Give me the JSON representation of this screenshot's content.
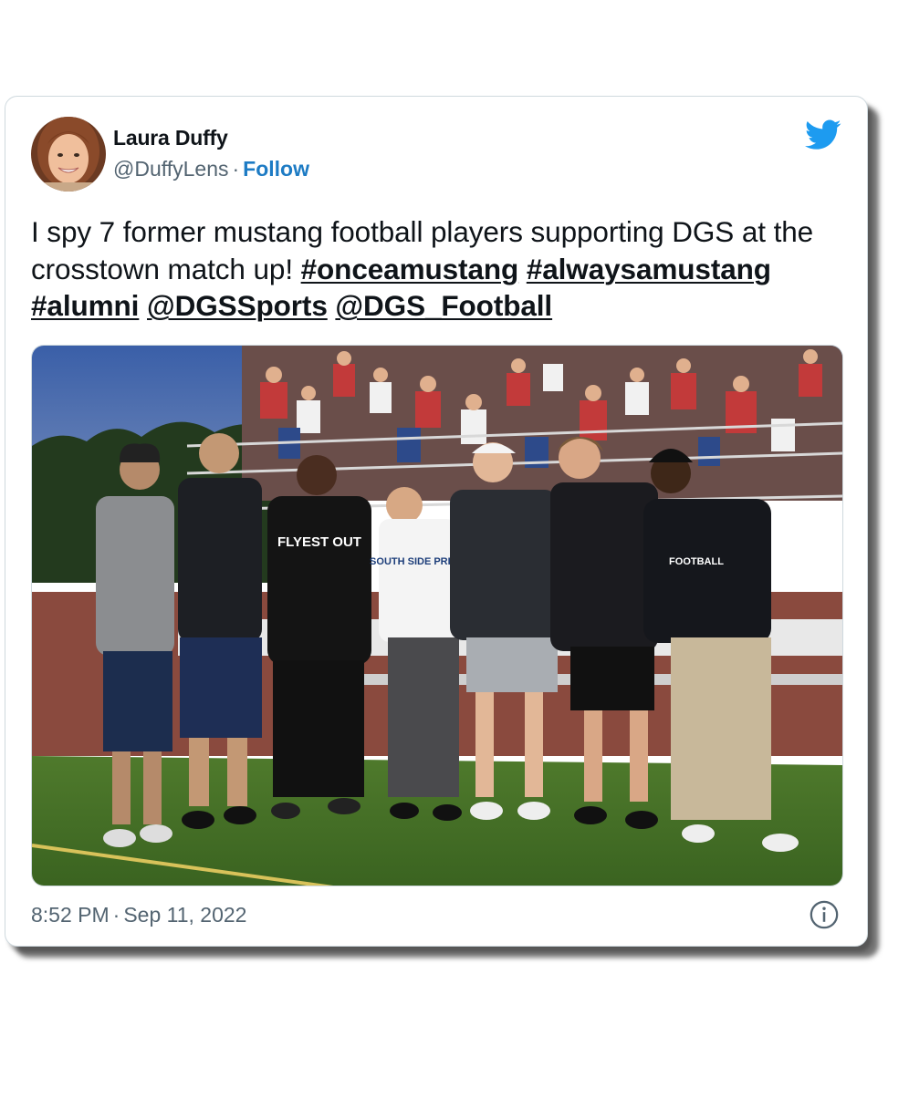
{
  "author": {
    "name": "Laura Duffy",
    "handle": "@DuffyLens",
    "separator": "·",
    "follow_label": "Follow"
  },
  "tweet": {
    "text_plain": "I spy 7 former mustang football players supporting DGS at the crosstown match up!",
    "tags": [
      "#onceamustang",
      "#alwaysamustang",
      "#alumni",
      "@DGSSports",
      "@DGS_Football"
    ],
    "time": "8:52 PM",
    "separator": "·",
    "date": "Sep 11, 2022"
  },
  "photo": {
    "shirt_texts": [
      "FLYEST OUT",
      "SOUTH SIDE PRIDE",
      "FOOTBALL"
    ]
  },
  "icons": {
    "brand": "twitter-bird-icon",
    "info": "info-icon"
  },
  "colors": {
    "link": "#1d7bc4",
    "twitter_blue": "#1d9bf0",
    "secondary_text": "#536471"
  }
}
